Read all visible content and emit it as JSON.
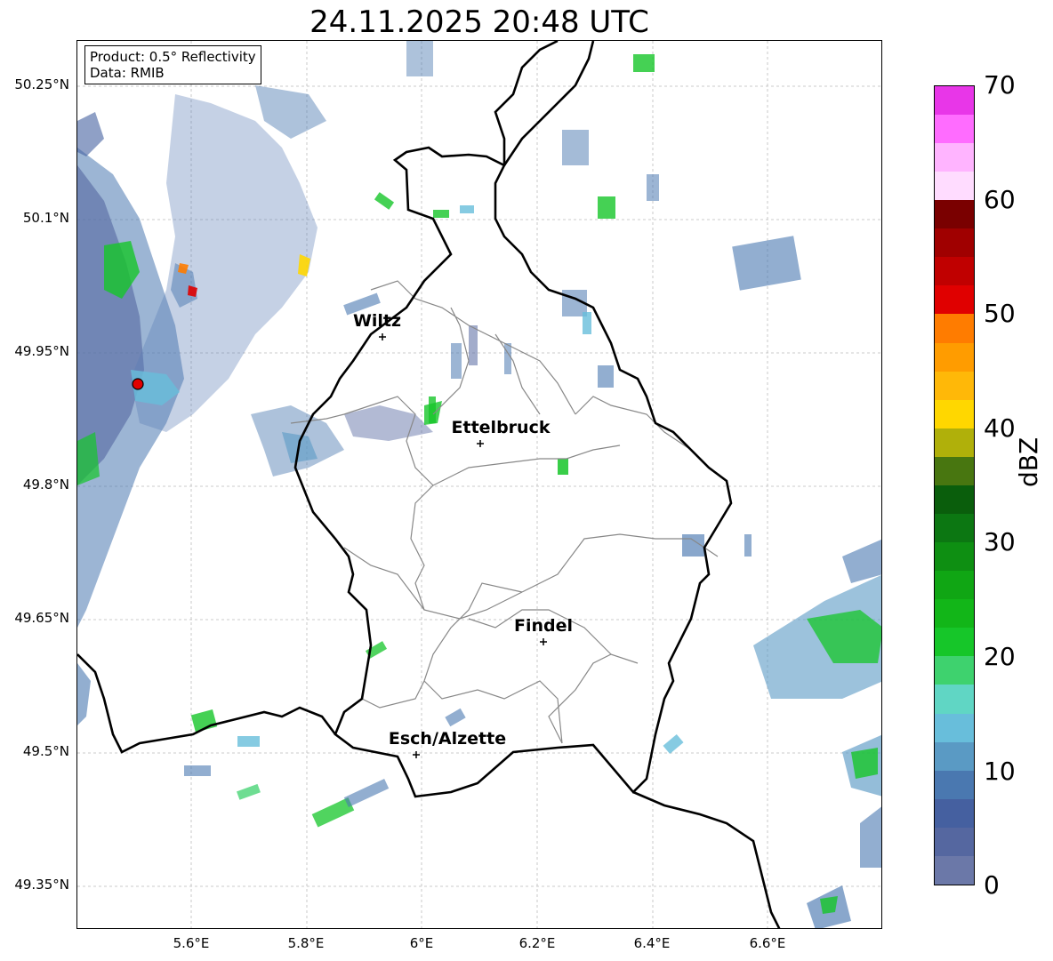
{
  "title": "24.11.2025 20:48 UTC",
  "info": {
    "product": "Product: 0.5° Reflectivity",
    "source": "Data: RMIB"
  },
  "axes": {
    "lat_labels": [
      "50.25°N",
      "50.1°N",
      "49.95°N",
      "49.8°N",
      "49.65°N",
      "49.5°N",
      "49.35°N"
    ],
    "lon_labels": [
      "5.6°E",
      "5.8°E",
      "6°E",
      "6.2°E",
      "6.4°E",
      "6.6°E"
    ]
  },
  "cities": [
    {
      "name": "Wiltz"
    },
    {
      "name": "Ettelbruck"
    },
    {
      "name": "Findel"
    },
    {
      "name": "Esch/Alzette"
    }
  ],
  "colorbar": {
    "label": "dBZ",
    "tick_labels": [
      "0",
      "10",
      "20",
      "30",
      "40",
      "50",
      "60",
      "70"
    ],
    "colors": [
      "#6b78a8",
      "#5567a0",
      "#4560a0",
      "#4a78b0",
      "#5a9ac4",
      "#68bedb",
      "#60d6c4",
      "#3ed26e",
      "#16c629",
      "#12b618",
      "#10a614",
      "#0e8f12",
      "#0c7712",
      "#0a5e0c",
      "#487610",
      "#b0b00a",
      "#ffd700",
      "#ffb808",
      "#ff9c00",
      "#ff7c00",
      "#e00000",
      "#c00000",
      "#a00000",
      "#7a0000",
      "#ffdcff",
      "#ffb4ff",
      "#ff6cff",
      "#e836e8"
    ]
  }
}
